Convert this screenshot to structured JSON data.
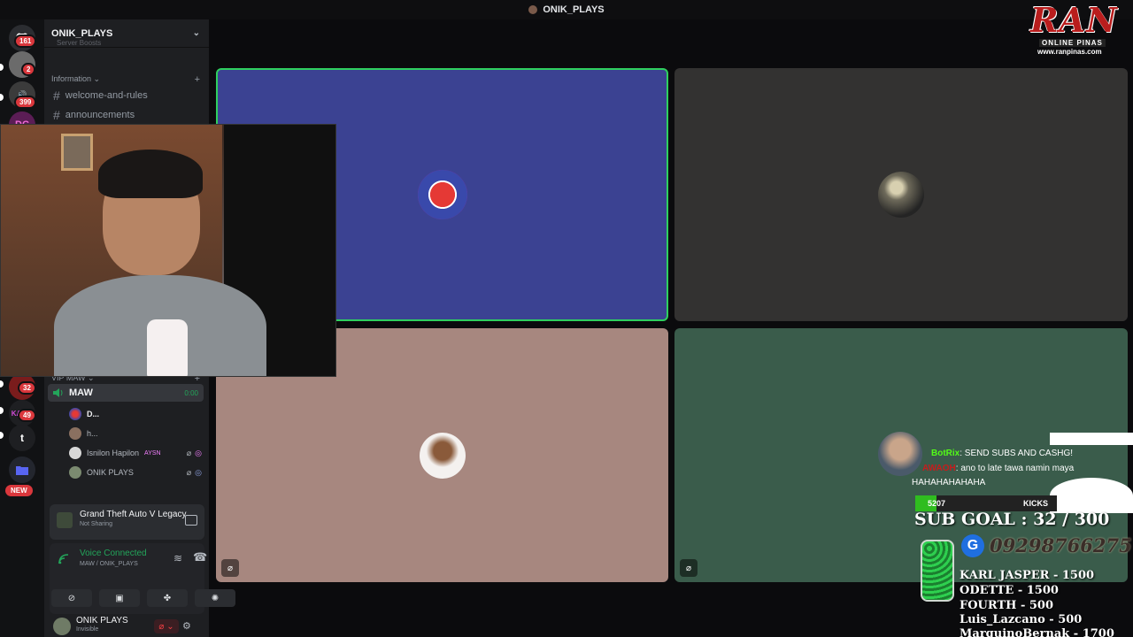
{
  "window": {
    "title": "ONIK_PLAYS"
  },
  "colors": {
    "accent_green": "#23a55a",
    "tile_blue": "#3b4292",
    "tile_gray": "#333231",
    "tile_pink": "#a7877f",
    "tile_green": "#3a5c4b",
    "badge_red": "#da373c"
  },
  "rail": {
    "items": [
      {
        "icon": "discord-icon",
        "badge": "161"
      },
      {
        "icon": "server-avatar-icon",
        "badge": "2"
      },
      {
        "icon": "server-speaker-icon",
        "badge": "399"
      },
      {
        "icon": "server-pink-icon",
        "badge": ""
      },
      {
        "icon": "server-red-icon",
        "badge": "32"
      },
      {
        "icon": "server-kaiye-icon",
        "badge": "49",
        "label": "KAIYE"
      },
      {
        "icon": "server-t-icon",
        "badge": "",
        "label": "t"
      },
      {
        "icon": "folder-icon",
        "badge": ""
      },
      {
        "icon": "new-badge-icon",
        "badge": "",
        "label": "NEW"
      }
    ]
  },
  "sidebar": {
    "server_name": "ONIK_PLAYS",
    "boost_label": "Server Boosts",
    "category": "Information",
    "channels": [
      {
        "name": "welcome-and-rules"
      },
      {
        "name": "announcements"
      }
    ],
    "voice_category": "VIP MAW",
    "voice_channel": {
      "name": "MAW",
      "timer": "0:00"
    },
    "voice_users": [
      {
        "name": "D..."
      },
      {
        "name": "h..."
      },
      {
        "name": "Isnilon Hapilon",
        "tag": "AYSN"
      },
      {
        "name": "ONIK PLAYS"
      }
    ]
  },
  "activity": {
    "title": "Grand Theft Auto V Legacy",
    "status": "Not Sharing"
  },
  "voice_panel": {
    "status": "Voice Connected",
    "location": "MAW / ONIK_PLAYS"
  },
  "user": {
    "name": "ONIK PLAYS",
    "status": "Invisible"
  },
  "logo": {
    "main": "RAN",
    "sub": "ONLINE PINAS",
    "url": "www.ranpinas.com"
  },
  "chat": [
    {
      "user": "BotRix",
      "text": ": SEND SUBS AND CASHG!"
    },
    {
      "user": "AWAOH",
      "text": ": ano to late tawa namin maya"
    },
    {
      "user": "",
      "text": "HAHAHAHAHAHA"
    }
  ],
  "kicks": {
    "count": "5207",
    "label": "KICKS"
  },
  "sub_goal": "SUB GOAL : 32 / 300",
  "gcash_number": "09298766275",
  "donors": [
    "KARL JASPER - 1500",
    "ODETTE - 1500",
    "FOURTH - 500",
    "Luis_Lazcano - 500",
    "MarquinoBernak - 1700"
  ]
}
